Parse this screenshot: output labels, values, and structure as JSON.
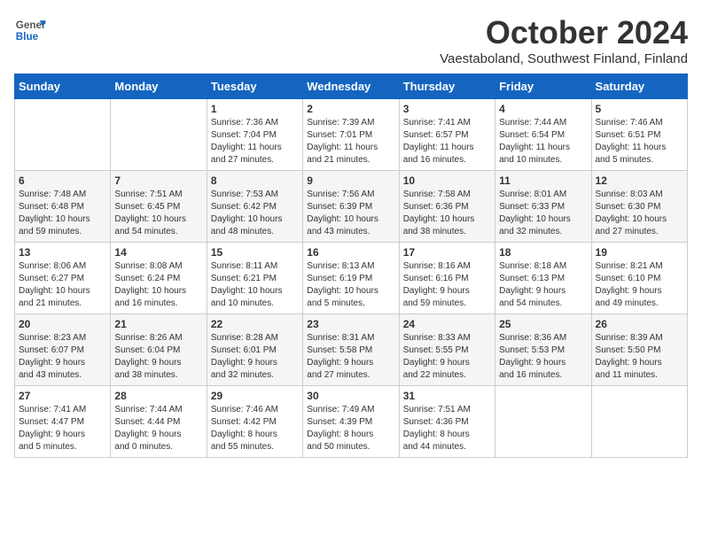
{
  "logo": {
    "general": "General",
    "blue": "Blue"
  },
  "header": {
    "title": "October 2024",
    "subtitle": "Vaestaboland, Southwest Finland, Finland"
  },
  "days_of_week": [
    "Sunday",
    "Monday",
    "Tuesday",
    "Wednesday",
    "Thursday",
    "Friday",
    "Saturday"
  ],
  "weeks": [
    [
      {
        "day": "",
        "info": ""
      },
      {
        "day": "",
        "info": ""
      },
      {
        "day": "1",
        "info": "Sunrise: 7:36 AM\nSunset: 7:04 PM\nDaylight: 11 hours\nand 27 minutes."
      },
      {
        "day": "2",
        "info": "Sunrise: 7:39 AM\nSunset: 7:01 PM\nDaylight: 11 hours\nand 21 minutes."
      },
      {
        "day": "3",
        "info": "Sunrise: 7:41 AM\nSunset: 6:57 PM\nDaylight: 11 hours\nand 16 minutes."
      },
      {
        "day": "4",
        "info": "Sunrise: 7:44 AM\nSunset: 6:54 PM\nDaylight: 11 hours\nand 10 minutes."
      },
      {
        "day": "5",
        "info": "Sunrise: 7:46 AM\nSunset: 6:51 PM\nDaylight: 11 hours\nand 5 minutes."
      }
    ],
    [
      {
        "day": "6",
        "info": "Sunrise: 7:48 AM\nSunset: 6:48 PM\nDaylight: 10 hours\nand 59 minutes."
      },
      {
        "day": "7",
        "info": "Sunrise: 7:51 AM\nSunset: 6:45 PM\nDaylight: 10 hours\nand 54 minutes."
      },
      {
        "day": "8",
        "info": "Sunrise: 7:53 AM\nSunset: 6:42 PM\nDaylight: 10 hours\nand 48 minutes."
      },
      {
        "day": "9",
        "info": "Sunrise: 7:56 AM\nSunset: 6:39 PM\nDaylight: 10 hours\nand 43 minutes."
      },
      {
        "day": "10",
        "info": "Sunrise: 7:58 AM\nSunset: 6:36 PM\nDaylight: 10 hours\nand 38 minutes."
      },
      {
        "day": "11",
        "info": "Sunrise: 8:01 AM\nSunset: 6:33 PM\nDaylight: 10 hours\nand 32 minutes."
      },
      {
        "day": "12",
        "info": "Sunrise: 8:03 AM\nSunset: 6:30 PM\nDaylight: 10 hours\nand 27 minutes."
      }
    ],
    [
      {
        "day": "13",
        "info": "Sunrise: 8:06 AM\nSunset: 6:27 PM\nDaylight: 10 hours\nand 21 minutes."
      },
      {
        "day": "14",
        "info": "Sunrise: 8:08 AM\nSunset: 6:24 PM\nDaylight: 10 hours\nand 16 minutes."
      },
      {
        "day": "15",
        "info": "Sunrise: 8:11 AM\nSunset: 6:21 PM\nDaylight: 10 hours\nand 10 minutes."
      },
      {
        "day": "16",
        "info": "Sunrise: 8:13 AM\nSunset: 6:19 PM\nDaylight: 10 hours\nand 5 minutes."
      },
      {
        "day": "17",
        "info": "Sunrise: 8:16 AM\nSunset: 6:16 PM\nDaylight: 9 hours\nand 59 minutes."
      },
      {
        "day": "18",
        "info": "Sunrise: 8:18 AM\nSunset: 6:13 PM\nDaylight: 9 hours\nand 54 minutes."
      },
      {
        "day": "19",
        "info": "Sunrise: 8:21 AM\nSunset: 6:10 PM\nDaylight: 9 hours\nand 49 minutes."
      }
    ],
    [
      {
        "day": "20",
        "info": "Sunrise: 8:23 AM\nSunset: 6:07 PM\nDaylight: 9 hours\nand 43 minutes."
      },
      {
        "day": "21",
        "info": "Sunrise: 8:26 AM\nSunset: 6:04 PM\nDaylight: 9 hours\nand 38 minutes."
      },
      {
        "day": "22",
        "info": "Sunrise: 8:28 AM\nSunset: 6:01 PM\nDaylight: 9 hours\nand 32 minutes."
      },
      {
        "day": "23",
        "info": "Sunrise: 8:31 AM\nSunset: 5:58 PM\nDaylight: 9 hours\nand 27 minutes."
      },
      {
        "day": "24",
        "info": "Sunrise: 8:33 AM\nSunset: 5:55 PM\nDaylight: 9 hours\nand 22 minutes."
      },
      {
        "day": "25",
        "info": "Sunrise: 8:36 AM\nSunset: 5:53 PM\nDaylight: 9 hours\nand 16 minutes."
      },
      {
        "day": "26",
        "info": "Sunrise: 8:39 AM\nSunset: 5:50 PM\nDaylight: 9 hours\nand 11 minutes."
      }
    ],
    [
      {
        "day": "27",
        "info": "Sunrise: 7:41 AM\nSunset: 4:47 PM\nDaylight: 9 hours\nand 5 minutes."
      },
      {
        "day": "28",
        "info": "Sunrise: 7:44 AM\nSunset: 4:44 PM\nDaylight: 9 hours\nand 0 minutes."
      },
      {
        "day": "29",
        "info": "Sunrise: 7:46 AM\nSunset: 4:42 PM\nDaylight: 8 hours\nand 55 minutes."
      },
      {
        "day": "30",
        "info": "Sunrise: 7:49 AM\nSunset: 4:39 PM\nDaylight: 8 hours\nand 50 minutes."
      },
      {
        "day": "31",
        "info": "Sunrise: 7:51 AM\nSunset: 4:36 PM\nDaylight: 8 hours\nand 44 minutes."
      },
      {
        "day": "",
        "info": ""
      },
      {
        "day": "",
        "info": ""
      }
    ]
  ]
}
